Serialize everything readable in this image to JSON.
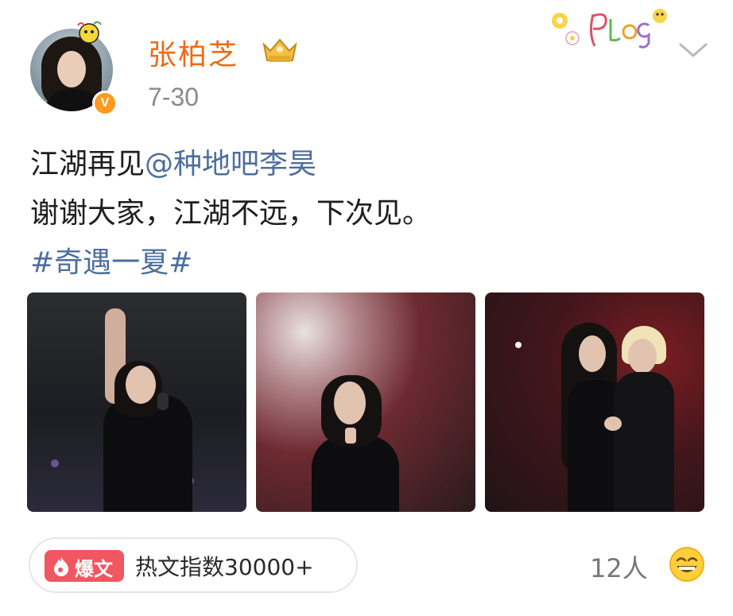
{
  "header": {
    "username": "张柏芝",
    "date": "7-30",
    "verified_mark": "V",
    "icons": [
      "avatar",
      "verified-badge-icon",
      "vip-crown-badge-icon",
      "plog-sticker-icon",
      "chevron-down-icon"
    ]
  },
  "content": {
    "line1_text": "江湖再见",
    "mention": "@种地吧李昊",
    "line2": "谢谢大家，江湖不远，下次见。",
    "hashtag": "#奇遇一夏#"
  },
  "images": [
    {
      "description_icon": "photo-performer-waving"
    },
    {
      "description_icon": "photo-performer-stage"
    },
    {
      "description_icon": "photo-duo-dance"
    }
  ],
  "footer": {
    "hot_badge_label": "爆文",
    "hot_index_text": "热文指数30000+",
    "people_count": "12人",
    "emoji_icon": "grinning-emoji-icon"
  },
  "colors": {
    "username": "#f06a15",
    "link": "#4d6e9e",
    "hot_badge": "#f25661",
    "verified": "#ff9a1f"
  }
}
